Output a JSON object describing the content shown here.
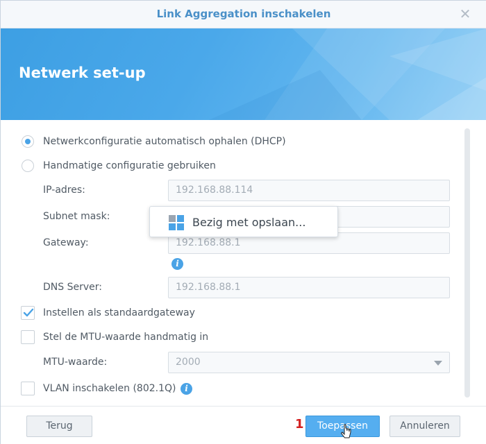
{
  "window": {
    "title": "Link Aggregation inschakelen",
    "close_icon": "close-icon"
  },
  "banner": {
    "title": "Netwerk set-up",
    "color": "#4aa8ea"
  },
  "network": {
    "dhcp_label": "Netwerkconfiguratie automatisch ophalen (DHCP)",
    "dhcp_selected": true,
    "manual_label": "Handmatige configuratie gebruiken",
    "manual_selected": false,
    "ip_label": "IP-adres:",
    "ip_value": "192.168.88.114",
    "subnet_label": "Subnet mask:",
    "subnet_value": "",
    "gateway_label": "Gateway:",
    "gateway_value": "192.168.88.1",
    "dns_label": "DNS Server:",
    "dns_value": "192.168.88.1",
    "default_gateway_label": "Instellen als standaardgateway",
    "default_gateway_checked": true,
    "mtu_manual_label": "Stel de MTU-waarde handmatig in",
    "mtu_manual_checked": false,
    "mtu_label": "MTU-waarde:",
    "mtu_value": "2000",
    "vlan_label": "VLAN inschakelen (802.1Q)",
    "vlan_checked": false
  },
  "toast": {
    "text": "Bezig met opslaan..."
  },
  "footer": {
    "back_label": "Terug",
    "apply_label": "Toepassen",
    "cancel_label": "Annuleren",
    "step_marker": "1"
  },
  "colors": {
    "accent": "#4aa3e6",
    "primary_button": "#55aef0",
    "title_text": "#4a90c8",
    "step_marker": "#d32020"
  }
}
